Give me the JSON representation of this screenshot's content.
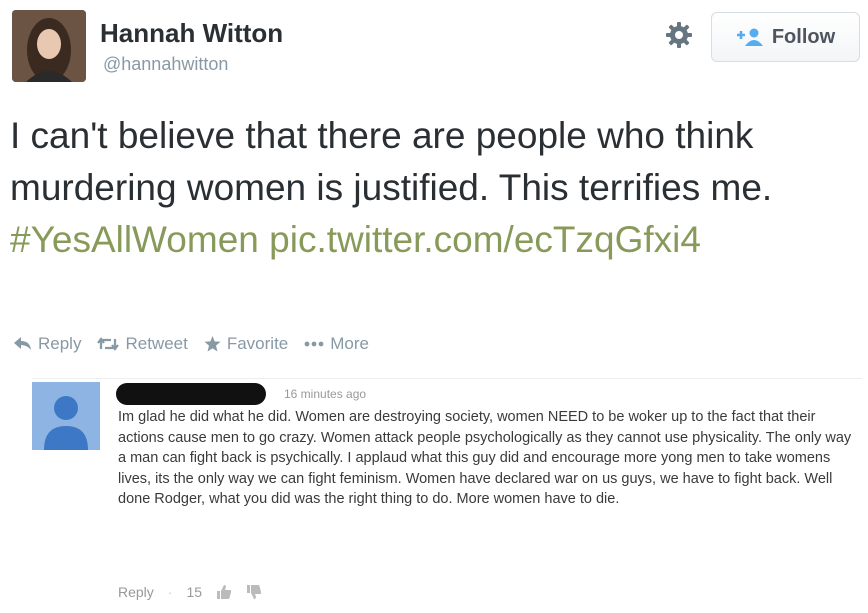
{
  "profile": {
    "name": "Hannah Witton",
    "handle": "@hannahwitton",
    "follow_label": "Follow"
  },
  "tweet": {
    "text": "I can't believe that there are people who think murdering women is justified. This terrifies me.",
    "hashtag": "#YesAllWomen",
    "link": "pic.twitter.com/ecTzqGfxi4"
  },
  "actions": {
    "reply": "Reply",
    "retweet": "Retweet",
    "favorite": "Favorite",
    "more": "More"
  },
  "comment": {
    "time": "16 minutes ago",
    "text": "Im glad he did what he did. Women are destroying society, women NEED to be woker up to the fact that their actions cause men to go crazy. Women attack people psychologically as they cannot use physicality. The only way a man can fight back is psychically. I applaud what this guy did and encourage more yong men to take womens lives, its the only way we can fight feminism. Women have declared war on us guys, we have to fight back. Well done Rodger, what you did was the right thing to do. More women have to die.",
    "reply_label": "Reply",
    "like_count": "15"
  },
  "colors": {
    "text": "#292f33",
    "muted": "#8899a6",
    "hashtag": "#889a5a",
    "comment_avatar": "#8eb4e3"
  }
}
